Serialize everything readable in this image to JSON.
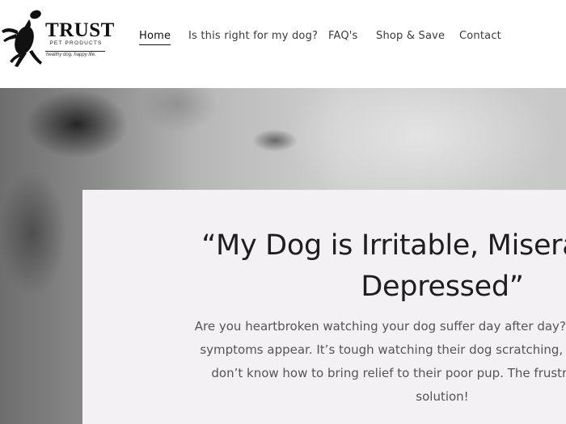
{
  "logo": {
    "brand": "TRUST",
    "sub": "PET PRODUCTS",
    "tagline": "healthy dog. happy life."
  },
  "nav": [
    {
      "label": "Home",
      "active": true
    },
    {
      "label": "Is this right for my dog?"
    },
    {
      "label": "FAQ's"
    },
    {
      "label": "Shop & Save"
    },
    {
      "label": "Contact"
    }
  ],
  "hero": {
    "title_lines": [
      "“My Dog is Irritable, Miserable and",
      "Depressed”"
    ],
    "body_lines": [
      "Are you heartbroken watching your dog suffer day after day? Most dog lovers will",
      "symptoms appear. It’s tough watching their dog scratching, chewing or shaking",
      "don’t know how to bring relief to their poor pup. The frustration can be over",
      "solution!"
    ]
  }
}
